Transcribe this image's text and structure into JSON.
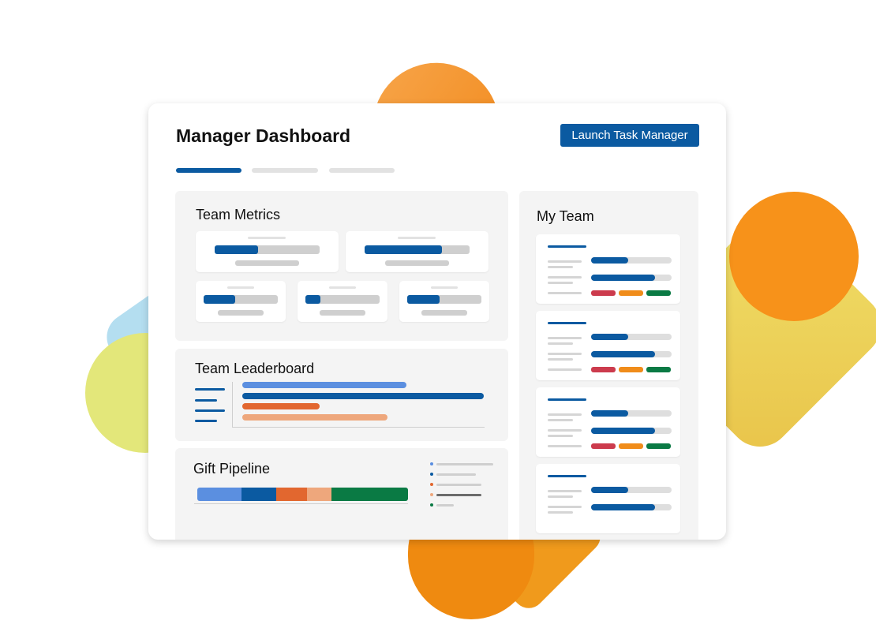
{
  "header": {
    "title": "Manager Dashboard",
    "launch_button_label": "Launch Task Manager"
  },
  "tabs": [
    {
      "state": "active"
    },
    {
      "state": "inactive"
    },
    {
      "state": "inactive"
    }
  ],
  "panels": {
    "team_metrics": {
      "title": "Team Metrics"
    },
    "team_leaderboard": {
      "title": "Team Leaderboard"
    },
    "gift_pipeline": {
      "title": "Gift Pipeline"
    },
    "my_team": {
      "title": "My Team"
    }
  },
  "metrics": [
    {
      "progress": 0.41
    },
    {
      "progress": 0.74
    },
    {
      "progress": 0.43
    },
    {
      "progress": 0.2
    },
    {
      "progress": 0.44
    }
  ],
  "leaderboard": [
    {
      "value": 0.68,
      "color": "#5b8fe0"
    },
    {
      "value": 1.0,
      "color": "#0b5aa1"
    },
    {
      "value": 0.32,
      "color": "#e2672f"
    },
    {
      "value": 0.6,
      "color": "#eea77c"
    }
  ],
  "pipeline_segments": [
    {
      "fraction": 0.21,
      "color": "#5b8fe0"
    },
    {
      "fraction": 0.165,
      "color": "#0b5aa1"
    },
    {
      "fraction": 0.145,
      "color": "#e2672f"
    },
    {
      "fraction": 0.115,
      "color": "#eea77c"
    },
    {
      "fraction": 0.365,
      "color": "#0a7a44"
    }
  ],
  "pipeline_legend_colors": [
    "#5b8fe0",
    "#0b5aa1",
    "#e2672f",
    "#eea77c",
    "#0a7a44"
  ],
  "team_members": [
    {
      "progress_1": 0.46,
      "progress_2": 0.79,
      "status_colors": [
        "#cc3b4d",
        "#f08c1a",
        "#0a7a44"
      ]
    },
    {
      "progress_1": 0.46,
      "progress_2": 0.79,
      "status_colors": [
        "#cc3b4d",
        "#f08c1a",
        "#0a7a44"
      ]
    },
    {
      "progress_1": 0.46,
      "progress_2": 0.79,
      "status_colors": [
        "#cc3b4d",
        "#f08c1a",
        "#0a7a44"
      ]
    },
    {
      "progress_1": 0.46,
      "progress_2": 0.79,
      "status_colors": []
    }
  ],
  "colors": {
    "accent": "#0b5aa1",
    "panel_bg": "#f4f4f4",
    "placeholder": "#cfcfcf"
  }
}
